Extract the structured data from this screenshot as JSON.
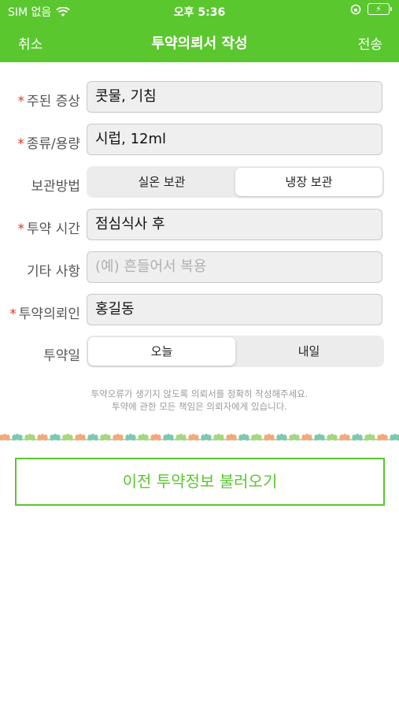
{
  "status_bar": {
    "carrier": "SIM 없음",
    "time": "오후 5:36",
    "battery_icon": "battery-charging-icon",
    "wifi_icon": "wifi-icon",
    "lock_icon": "orientation-lock-icon"
  },
  "nav": {
    "cancel": "취소",
    "title": "투약의뢰서 작성",
    "send": "전송"
  },
  "form": {
    "symptom": {
      "label": "주된 증상",
      "value": "콧물, 기침"
    },
    "type_dose": {
      "label": "종류/용량",
      "value": "시럽, 12ml"
    },
    "storage": {
      "label": "보관방법",
      "options": [
        "실온 보관",
        "냉장 보관"
      ],
      "selected": "냉장 보관"
    },
    "dose_time": {
      "label": "투약 시간",
      "value": "점심식사 후"
    },
    "etc": {
      "label": "기타 사항",
      "placeholder": "(예) 흔들어서 복용"
    },
    "requester": {
      "label": "투약의뢰인",
      "value": "홍길동"
    },
    "dose_day": {
      "label": "투약일",
      "options": [
        "오늘",
        "내일"
      ],
      "selected": "오늘"
    }
  },
  "notice": {
    "line1": "투약오류가 생기지 않도록 의뢰서를 정확히 작성해주세요.",
    "line2": "투약에 관한 모든 책임은 의뢰자에게 있습니다."
  },
  "load_button": "이전 투약정보 불러오기",
  "colors": {
    "accent": "#5ac72f",
    "required": "#e0362a"
  }
}
